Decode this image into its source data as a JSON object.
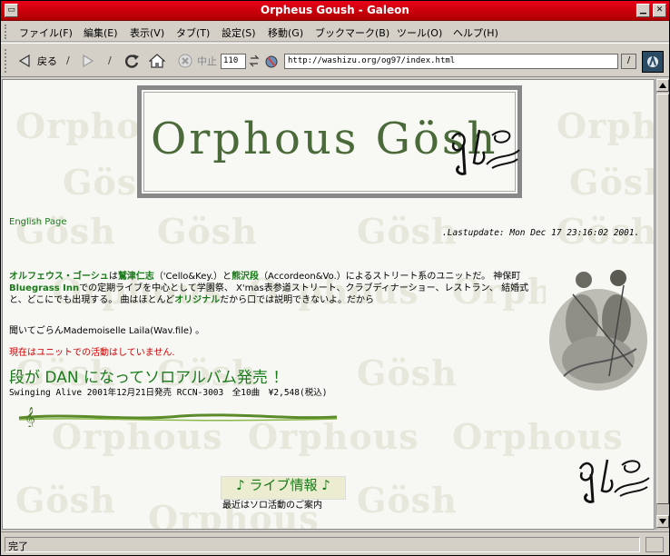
{
  "window": {
    "title": "Orpheus Goush - Galeon"
  },
  "menu": [
    "ファイル(F)",
    "編集(E)",
    "表示(V)",
    "タブ(T)",
    "設定(S)",
    "移動(G)",
    "ブックマーク(B)",
    "ツール(O)",
    "ヘルプ(H)"
  ],
  "toolbar": {
    "back_label": "戻る",
    "stop_label": "中止",
    "zoom_value": "110",
    "url_value": "http://washizu.org/og97/index.html",
    "separator": "/"
  },
  "page": {
    "banner_title": "Orphous Gösh",
    "english_link": "English Page",
    "last_update": ".Lastupdate: Mon Dec 17 23:16:02 2001.",
    "intro": {
      "group_name": "オルフェウス・ゴーシュ",
      "p1": "は",
      "member1": "鷲津仁志",
      "p2": "（'Cello&Key.）と",
      "member2": "熊沢段",
      "p3": "（Accordeon&Vo.）によるストリート系のユニットだ。 神保町",
      "venue": "Bluegrass Inn",
      "p4": "での定期ライブを中心として学園祭、 X'mas表参道ストリート、クラブディナーショー、レストラン、 結婚式と、どこにでも出現する。 曲はほとんど",
      "original": "オリジナル",
      "p5": "だから口では説明できないよ。だから"
    },
    "listen": "聞いてごらんMademoiselle Laila(Wav.file) 。",
    "notice": "現在はユニットでの活動はしていません.",
    "album_headline": "段が DAN になってソロアルバム発売 ！",
    "album_info": "Swinging Alive 2001年12月21日発売 RCCN-3003　全10曲　¥2,548(税込)",
    "live_title": "♪ ライブ情報 ♪",
    "live_sub": "最近はソロ活動のご案内",
    "watermark": [
      "Orphous",
      "Gösh"
    ]
  },
  "status": {
    "text": "完了"
  }
}
